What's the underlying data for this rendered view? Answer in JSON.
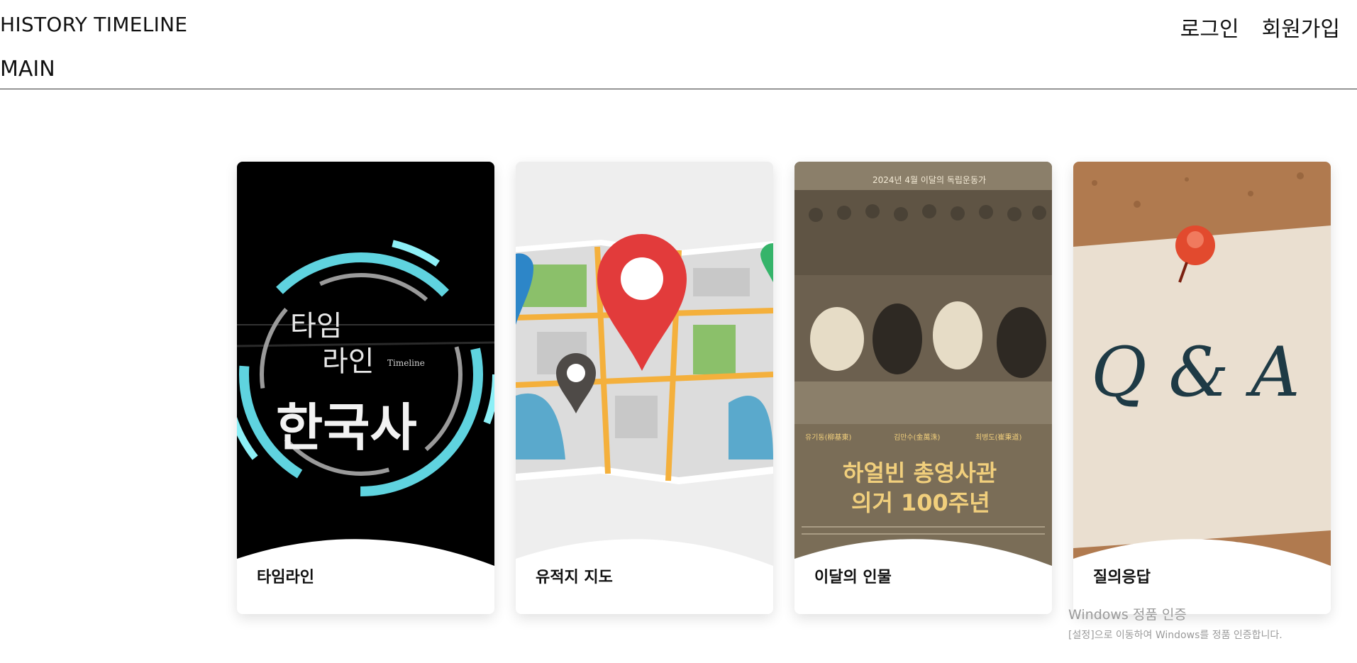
{
  "header": {
    "brand": "HISTORY TIMELINE",
    "main_link": "MAIN",
    "login": "로그인",
    "signup": "회원가입"
  },
  "cards": [
    {
      "label": "타임라인",
      "image_text": {
        "line1": "타임",
        "line2": "라인",
        "sub": "Timeline",
        "big": "한국사"
      }
    },
    {
      "label": "유적지 지도"
    },
    {
      "label": "이달의 인물",
      "image_text": {
        "top": "2024년 4월 이달의 독립운동가",
        "names": [
          "유기동(柳基東)",
          "김만수(金萬洙)",
          "최병도(崔秉道)"
        ],
        "title1": "하얼빈 총영사관",
        "title2": "의거 100주년"
      }
    },
    {
      "label": "질의응답",
      "image_text": {
        "big": "Q & A"
      }
    }
  ],
  "watermark": {
    "title": "Windows 정품 인증",
    "sub": "[설정]으로 이동하여 Windows를 정품 인증합니다."
  },
  "colors": {
    "timeline_cyan": "#5fd3df",
    "map_pin_red": "#e23b3b",
    "photo_sepia": "#7a6d57",
    "cork_brown": "#b07a4f"
  }
}
